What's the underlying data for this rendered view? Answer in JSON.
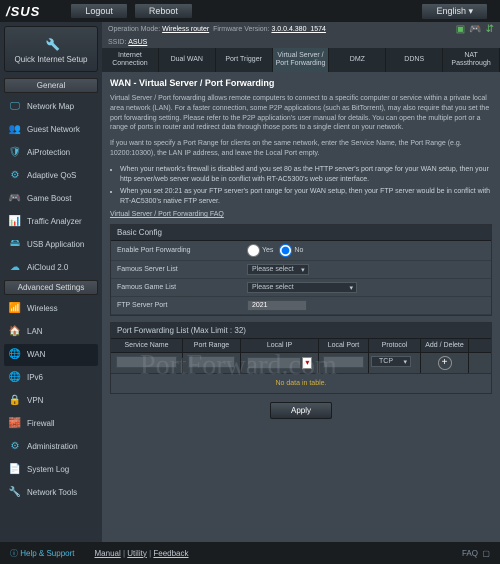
{
  "header": {
    "brand": "/SUS",
    "logout": "Logout",
    "reboot": "Reboot",
    "english": "English"
  },
  "info": {
    "op_mode_label": "Operation Mode:",
    "op_mode": "Wireless router",
    "fw_label": "Firmware Version:",
    "fw_version": "3.0.0.4.380_1574",
    "ssid_label": "SSID:",
    "ssid": "ASUS"
  },
  "tabs": [
    "Internet Connection",
    "Dual WAN",
    "Port Trigger",
    "Virtual Server / Port Forwarding",
    "DMZ",
    "DDNS",
    "NAT Passthrough"
  ],
  "sidebar": {
    "quick": "Quick Internet Setup",
    "general": "General",
    "general_items": [
      "Network Map",
      "Guest Network",
      "AiProtection",
      "Adaptive QoS",
      "Game Boost",
      "Traffic Analyzer",
      "USB Application",
      "AiCloud 2.0"
    ],
    "advanced": "Advanced Settings",
    "advanced_items": [
      "Wireless",
      "LAN",
      "WAN",
      "IPv6",
      "VPN",
      "Firewall",
      "Administration",
      "System Log",
      "Network Tools"
    ]
  },
  "page": {
    "title": "WAN - Virtual Server / Port Forwarding",
    "desc1": "Virtual Server / Port forwarding allows remote computers to connect to a specific computer or service within a private local area network (LAN). For a faster connection, some P2P applications (such as BitTorrent), may also require that you set the port forwarding setting. Please refer to the P2P application's user manual for details. You can open the multiple port or a range of ports in router and redirect data through those ports to a single client on your network.",
    "desc2": "If you want to specify a Port Range for clients on the same network, enter the Service Name, the Port Range (e.g. 10200:10300), the LAN IP address, and leave the Local Port empty.",
    "bullet1": "When your network's firewall is disabled and you set 80 as the HTTP server's port range for your WAN setup, then your http server/web server would be in conflict with RT-AC5300's web user interface.",
    "bullet2": "When you set 20:21 as your FTP server's port range for your WAN setup, then your FTP server would be in conflict with RT-AC5300's native FTP server.",
    "faq": "Virtual Server / Port Forwarding FAQ",
    "basic_config": "Basic Config",
    "enable_pf": "Enable Port Forwarding",
    "yes": "Yes",
    "no": "No",
    "famous_server": "Famous Server List",
    "famous_game": "Famous Game List",
    "please_select": "Please select",
    "ftp_port": "FTP Server Port",
    "ftp_port_value": "2021",
    "pf_list": "Port Forwarding List (Max Limit : 32)",
    "cols": [
      "Service Name",
      "Port Range",
      "Local IP",
      "Local Port",
      "Protocol",
      "Add / Delete"
    ],
    "protocol_val": "TCP",
    "no_data": "No data in table.",
    "apply": "Apply"
  },
  "footer": {
    "help": "Help & Support",
    "manual": "Manual",
    "utility": "Utility",
    "feedback": "Feedback",
    "faq": "FAQ"
  },
  "watermark": "PortForward.com"
}
